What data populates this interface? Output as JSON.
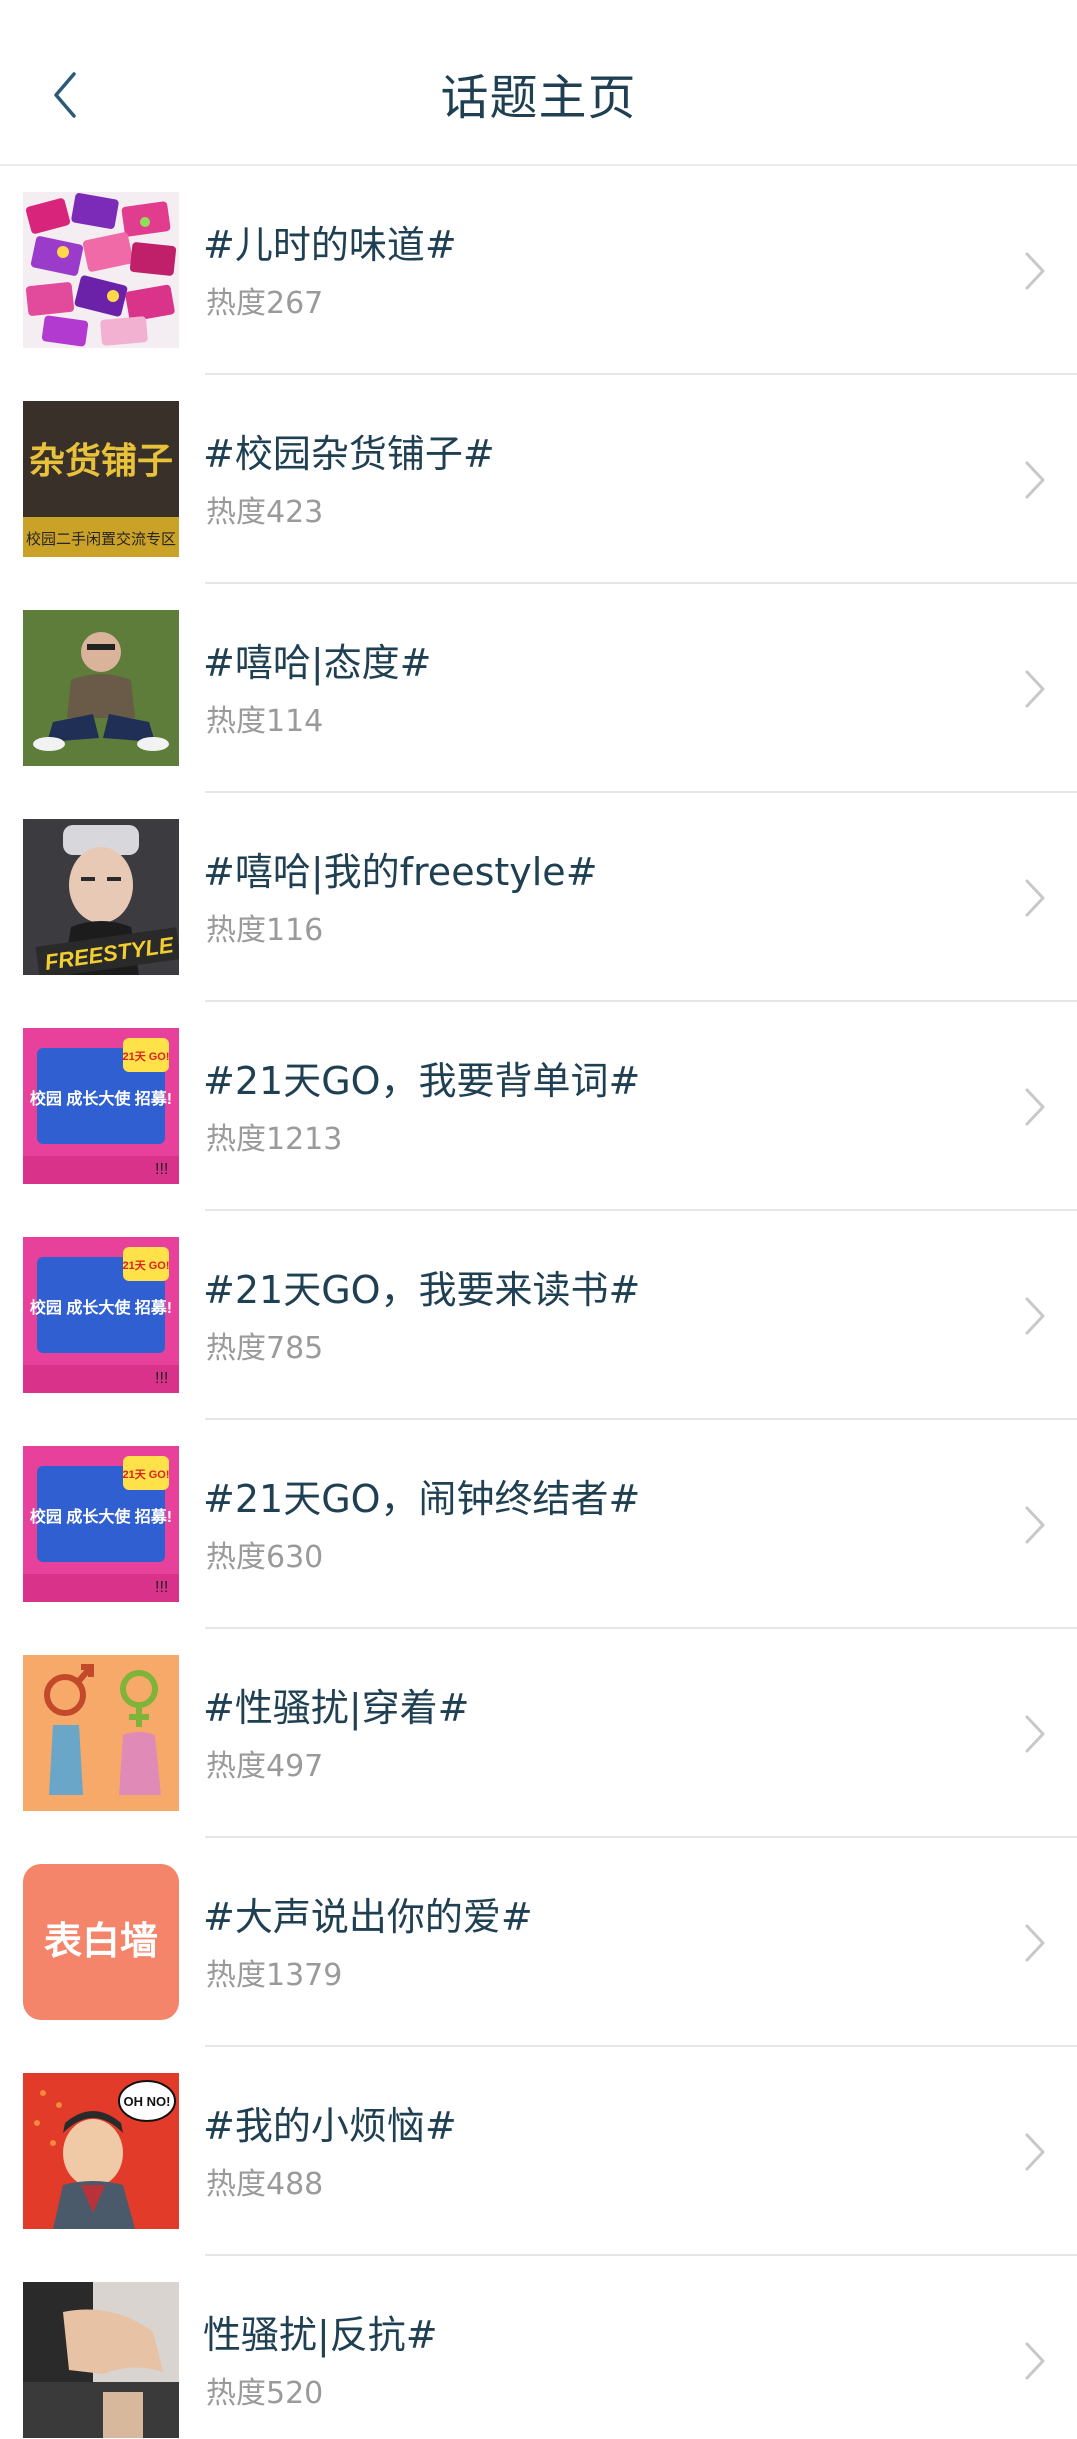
{
  "header": {
    "title": "话题主页",
    "back_icon": "chevron-left-icon"
  },
  "colors": {
    "title_text": "#1f3f52",
    "heat_text": "#9a9a9a",
    "divider": "#e6e6e6",
    "chevron": "#c8c8c8"
  },
  "topics": [
    {
      "title": "#儿时的味道#",
      "heat": "热度267",
      "thumb": "candy-photo"
    },
    {
      "title": "#校园杂货铺子#",
      "heat": "热度423",
      "thumb": "grocery-shop-sign",
      "thumb_text": "杂货铺子",
      "thumb_sub": "校园二手闲置交流专区"
    },
    {
      "title": "#嘻哈|态度#",
      "heat": "热度114",
      "thumb": "hiphop-figure-green"
    },
    {
      "title": "#嘻哈|我的freestyle#",
      "heat": "热度116",
      "thumb": "freestyle-portrait",
      "thumb_text": "FREESTYLE"
    },
    {
      "title": "#21天GO，我要背单词#",
      "heat": "热度1213",
      "thumb": "campus-ambassador-poster",
      "thumb_text": "校园 成长大使 招募!",
      "thumb_badge": "21天 GO!"
    },
    {
      "title": "#21天GO，我要来读书#",
      "heat": "热度785",
      "thumb": "campus-ambassador-poster",
      "thumb_text": "校园 成长大使 招募!",
      "thumb_badge": "21天 GO!"
    },
    {
      "title": "#21天GO，闹钟终结者#",
      "heat": "热度630",
      "thumb": "campus-ambassador-poster",
      "thumb_text": "校园 成长大使 招募!",
      "thumb_badge": "21天 GO!"
    },
    {
      "title": "#性骚扰|穿着#",
      "heat": "热度497",
      "thumb": "gender-symbols-illustration"
    },
    {
      "title": "#大声说出你的爱#",
      "heat": "热度1379",
      "thumb": "confession-wall",
      "thumb_text": "表白墙"
    },
    {
      "title": "#我的小烦恼#",
      "heat": "热度488",
      "thumb": "oh-no-comic",
      "thumb_text": "OH NO!"
    },
    {
      "title": "性骚扰|反抗#",
      "heat": "热度520",
      "thumb": "harassment-photo"
    }
  ]
}
